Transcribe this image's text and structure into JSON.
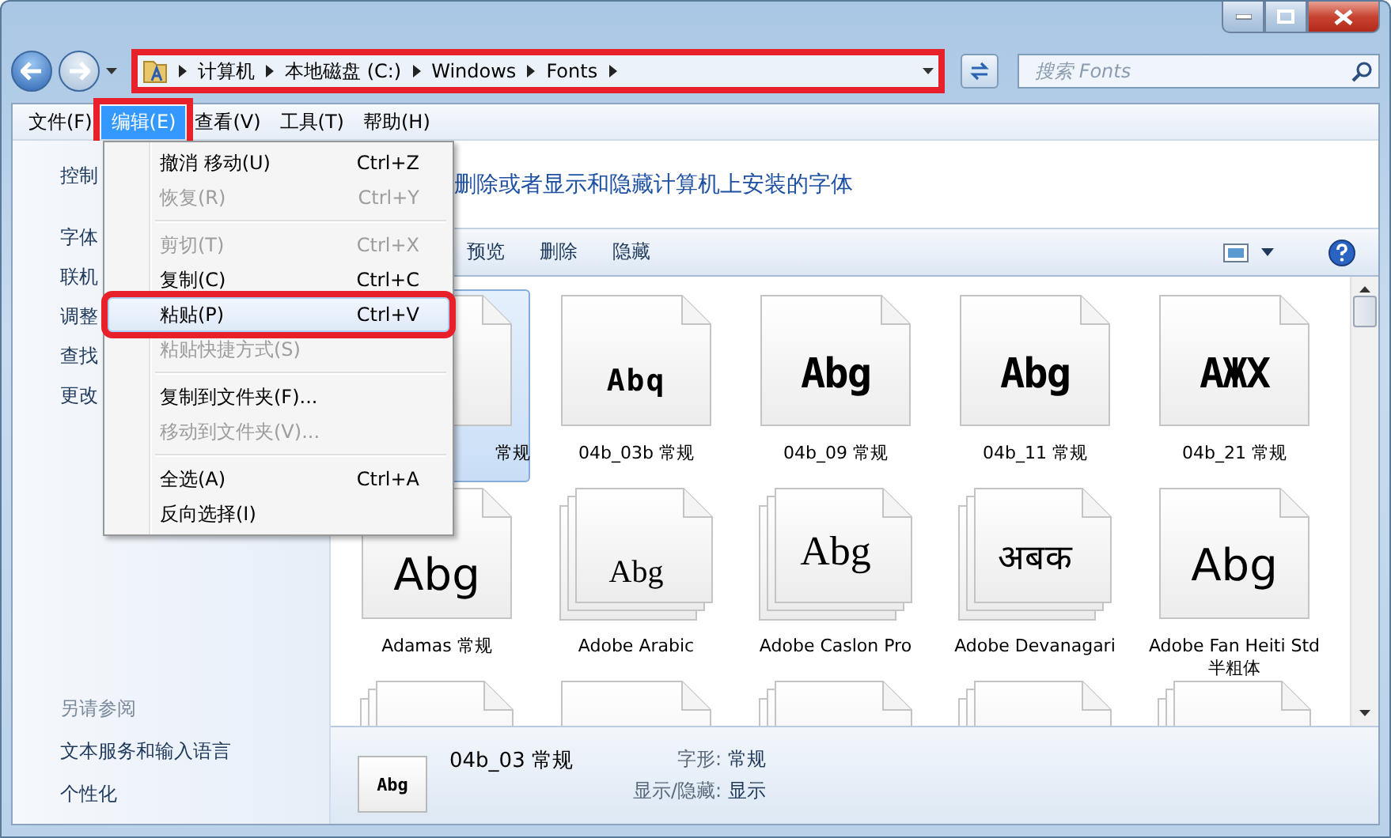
{
  "address_bar": {
    "crumbs": [
      "计算机",
      "本地磁盘 (C:)",
      "Windows",
      "Fonts"
    ],
    "highlighted": true
  },
  "search": {
    "placeholder": "搜索 Fonts"
  },
  "menu_bar": [
    {
      "label": "文件(F)",
      "selected": false,
      "highlighted": false
    },
    {
      "label": "编辑(E)",
      "selected": true,
      "highlighted": true
    },
    {
      "label": "查看(V)",
      "selected": false,
      "highlighted": false
    },
    {
      "label": "工具(T)",
      "selected": false,
      "highlighted": false
    },
    {
      "label": "帮助(H)",
      "selected": false,
      "highlighted": false
    }
  ],
  "edit_menu": {
    "groups": [
      [
        {
          "label": "撤消 移动(U)",
          "shortcut": "Ctrl+Z",
          "disabled": false,
          "hovered": false,
          "highlighted": false
        },
        {
          "label": "恢复(R)",
          "shortcut": "Ctrl+Y",
          "disabled": true,
          "hovered": false,
          "highlighted": false
        }
      ],
      [
        {
          "label": "剪切(T)",
          "shortcut": "Ctrl+X",
          "disabled": true,
          "hovered": false,
          "highlighted": false
        },
        {
          "label": "复制(C)",
          "shortcut": "Ctrl+C",
          "disabled": false,
          "hovered": false,
          "highlighted": false
        },
        {
          "label": "粘贴(P)",
          "shortcut": "Ctrl+V",
          "disabled": false,
          "hovered": true,
          "highlighted": true
        },
        {
          "label": "粘贴快捷方式(S)",
          "disabled": true,
          "hovered": false,
          "highlighted": false
        }
      ],
      [
        {
          "label": "复制到文件夹(F)...",
          "disabled": false,
          "hovered": false,
          "highlighted": false
        },
        {
          "label": "移动到文件夹(V)...",
          "disabled": true,
          "hovered": false,
          "highlighted": false
        }
      ],
      [
        {
          "label": "全选(A)",
          "shortcut": "Ctrl+A",
          "disabled": false,
          "hovered": false,
          "highlighted": false
        },
        {
          "label": "反向选择(I)",
          "disabled": false,
          "hovered": false,
          "highlighted": false
        }
      ]
    ]
  },
  "left_pane": {
    "links": [
      "控制",
      "字体",
      "联机",
      "调整",
      "查找",
      "更改"
    ],
    "see_also": {
      "heading": "另请参阅",
      "links": [
        "文本服务和输入语言",
        "个性化"
      ]
    }
  },
  "header": "删除或者显示和隐藏计算机上安装的字体",
  "toolbar": {
    "buttons": [
      "预览",
      "删除",
      "隐藏"
    ]
  },
  "fonts": [
    {
      "label": "常规",
      "kind": "single",
      "selected": true
    },
    {
      "label": "04b_03b 常规",
      "preview": "Abq",
      "kind": "single",
      "selected": false
    },
    {
      "label": "04b_09 常规",
      "preview": "Abg",
      "kind": "single",
      "selected": false
    },
    {
      "label": "04b_11 常规",
      "preview": "Abg",
      "kind": "single",
      "selected": false
    },
    {
      "label": "04b_21 常规",
      "preview": "AЖX",
      "kind": "single",
      "selected": false
    },
    {
      "label": "Adamas 常规",
      "preview": "Abg",
      "kind": "single",
      "selected": false
    },
    {
      "label": "Adobe Arabic",
      "preview": "Abg",
      "kind": "family",
      "selected": false
    },
    {
      "label": "Adobe Caslon Pro",
      "preview": "Abg",
      "kind": "family",
      "selected": false
    },
    {
      "label": "Adobe Devanagari",
      "preview": "अबक",
      "kind": "family",
      "selected": false
    },
    {
      "label": "Adobe Fan Heiti Std 半粗体",
      "preview": "Abg",
      "kind": "single",
      "selected": false
    },
    {
      "kind": "family",
      "selected": false
    },
    {
      "kind": "single",
      "selected": false
    },
    {
      "kind": "family",
      "selected": false
    },
    {
      "kind": "family",
      "selected": false
    },
    {
      "kind": "family",
      "selected": false
    }
  ],
  "details": {
    "thumbnail": "Abg",
    "name": "04b_03 常规",
    "fields": [
      {
        "label": "字形:",
        "value": "常规"
      },
      {
        "label": "显示/隐藏:",
        "value": "显示"
      }
    ]
  }
}
